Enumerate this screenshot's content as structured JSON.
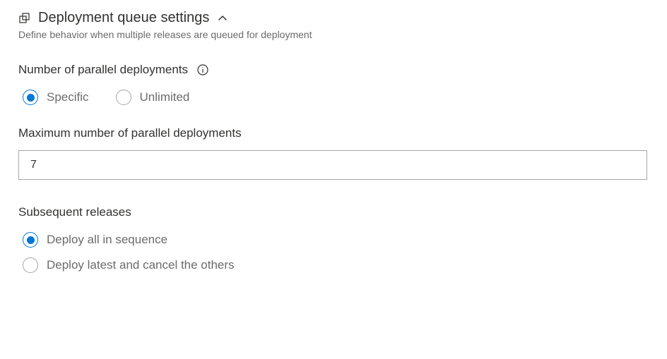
{
  "section": {
    "title": "Deployment queue settings",
    "subtitle": "Define behavior when multiple releases are queued for deployment"
  },
  "fields": {
    "parallel_deployments": {
      "label": "Number of parallel deployments",
      "options": {
        "specific": "Specific",
        "unlimited": "Unlimited"
      }
    },
    "max_parallel": {
      "label": "Maximum number of parallel deployments",
      "value": "7"
    },
    "subsequent_releases": {
      "label": "Subsequent releases",
      "options": {
        "sequence": "Deploy all in sequence",
        "latest": "Deploy latest and cancel the others"
      }
    }
  }
}
